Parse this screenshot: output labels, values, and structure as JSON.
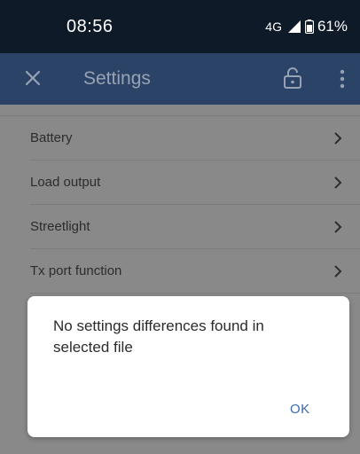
{
  "status_bar": {
    "time": "08:56",
    "network": "4G",
    "battery": "61%"
  },
  "app_bar": {
    "title": "Settings",
    "icons": [
      "close-icon",
      "lock-open-icon",
      "more-vert-icon"
    ]
  },
  "settings_list": {
    "items": [
      {
        "label": "Battery"
      },
      {
        "label": "Load output"
      },
      {
        "label": "Streetlight"
      },
      {
        "label": "Tx port function"
      }
    ]
  },
  "dialog": {
    "message": "No settings differences found in selected file",
    "ok_label": "OK"
  },
  "colors": {
    "status_bar_bg": "#0f1a29",
    "app_bar_bg": "#2b4366",
    "scrim_bg": "#898989",
    "accent": "#3c6ab0"
  }
}
